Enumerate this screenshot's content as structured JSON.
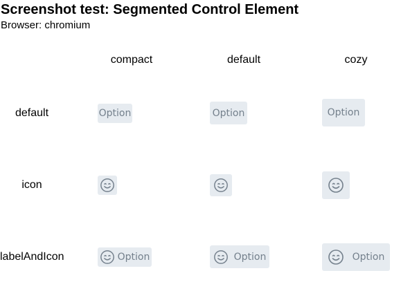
{
  "header": {
    "title": "Screenshot test: Segmented Control Element",
    "browser": "Browser: chromium"
  },
  "columns": [
    "compact",
    "default",
    "cozy"
  ],
  "rows": [
    "default",
    "icon",
    "labelAndIcon"
  ],
  "segment": {
    "label": "Option",
    "icon": "smiley-face-icon"
  },
  "colors": {
    "segment_bg": "#e6ebf0",
    "segment_fg": "#74808c"
  }
}
